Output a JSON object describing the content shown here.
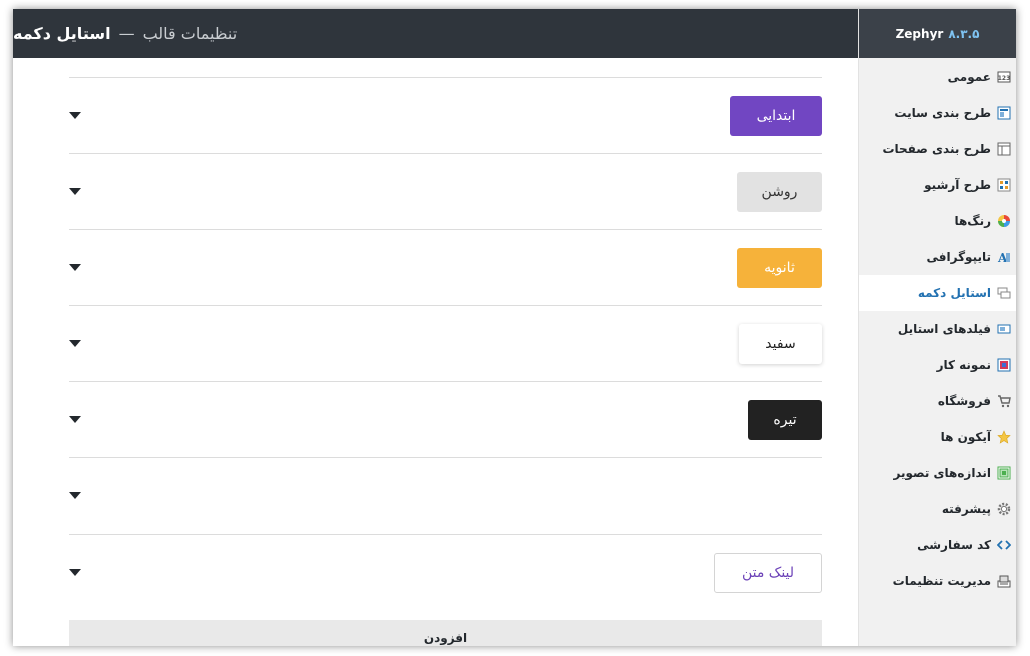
{
  "brand": {
    "name": "Zephyr",
    "version": "۸.۳.۵"
  },
  "header": {
    "title": "تنظیمات قالب",
    "separator": "—",
    "subtitle": "استایل دکمه"
  },
  "sidebar": {
    "items": [
      {
        "label": "عمومی",
        "icon": "general-icon"
      },
      {
        "label": "طرح بندی سایت",
        "icon": "site-layout-icon"
      },
      {
        "label": "طرح بندی صفحات",
        "icon": "page-layout-icon"
      },
      {
        "label": "طرح آرشیو",
        "icon": "archive-icon"
      },
      {
        "label": "رنگ‌ها",
        "icon": "color-wheel-icon"
      },
      {
        "label": "تایپوگرافی",
        "icon": "typography-icon"
      },
      {
        "label": "استایل دکمه",
        "icon": "button-style-icon"
      },
      {
        "label": "فیلدهای استایل",
        "icon": "style-fields-icon"
      },
      {
        "label": "نمونه کار",
        "icon": "portfolio-icon"
      },
      {
        "label": "فروشگاه",
        "icon": "cart-icon"
      },
      {
        "label": "آیکون ها",
        "icon": "star-icon"
      },
      {
        "label": "اندازه‌های تصویر",
        "icon": "image-sizes-icon"
      },
      {
        "label": "پیشرفته",
        "icon": "gear-icon"
      },
      {
        "label": "کد سفارشی",
        "icon": "code-icon"
      },
      {
        "label": "مدیریت تنظیمات",
        "icon": "settings-manager-icon"
      }
    ],
    "active_index": 6
  },
  "buttons": {
    "primary": "ابتدایی",
    "light": "روشن",
    "secondary": "ثانویه",
    "white": "سفید",
    "dark": "تیره",
    "link": "لینک متن"
  },
  "colors": {
    "primary": "#7146c2",
    "light": "#e2e2e2",
    "secondary": "#f6b23a",
    "dark": "#222222",
    "active_nav": "#2271b1"
  },
  "add_label": "افزودن"
}
